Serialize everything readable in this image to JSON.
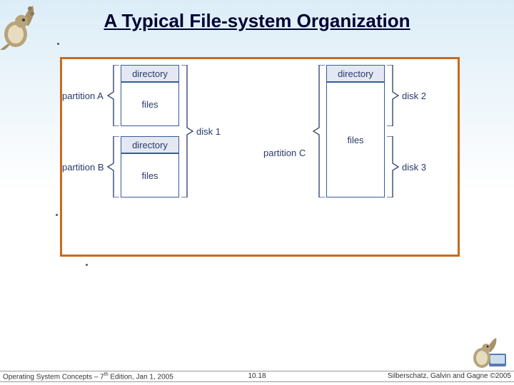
{
  "title": "A Typical File-system Organization",
  "diagram": {
    "left_stack": {
      "dirA": "directory",
      "filesA": "files",
      "dirB": "directory",
      "filesB": "files"
    },
    "right_stack": {
      "dirC": "directory",
      "filesC": "files"
    },
    "brackets": {
      "partitionA": "partition A",
      "partitionB": "partition B",
      "disk1": "disk 1",
      "partitionC": "partition C",
      "disk2": "disk 2",
      "disk3": "disk 3"
    }
  },
  "footer": {
    "left_prefix": "Operating System Concepts – 7",
    "left_sup": "th",
    "left_suffix": " Edition, Jan 1, 2005",
    "center": "10.18",
    "right": "Silberschatz, Galvin and Gagne ©2005"
  }
}
